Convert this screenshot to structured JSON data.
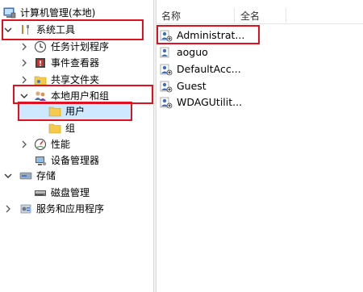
{
  "tree": {
    "root": {
      "label": "计算机管理(本地)",
      "icon": "computer-management-icon"
    },
    "system_tools": {
      "label": "系统工具",
      "icon": "tools-icon",
      "expanded": true
    },
    "task_scheduler": {
      "label": "任务计划程序",
      "icon": "clock-icon"
    },
    "event_viewer": {
      "label": "事件查看器",
      "icon": "event-viewer-icon"
    },
    "shared_folders": {
      "label": "共享文件夹",
      "icon": "shared-folder-icon"
    },
    "local_users_groups": {
      "label": "本地用户和组",
      "icon": "users-icon",
      "expanded": true
    },
    "users": {
      "label": "用户",
      "icon": "folder-icon",
      "selected": true
    },
    "groups": {
      "label": "组",
      "icon": "folder-icon"
    },
    "performance": {
      "label": "性能",
      "icon": "performance-icon"
    },
    "device_manager": {
      "label": "设备管理器",
      "icon": "device-manager-icon"
    },
    "storage": {
      "label": "存储",
      "icon": "storage-icon",
      "expanded": true
    },
    "disk_management": {
      "label": "磁盘管理",
      "icon": "disk-icon"
    },
    "services_apps": {
      "label": "服务和应用程序",
      "icon": "services-icon"
    }
  },
  "list": {
    "columns": [
      "名称",
      "全名"
    ],
    "rows": [
      {
        "name": "Administrat...",
        "icon": "user-icon"
      },
      {
        "name": "aoguo",
        "icon": "user-icon"
      },
      {
        "name": "DefaultAcc...",
        "icon": "user-icon"
      },
      {
        "name": "Guest",
        "icon": "user-icon"
      },
      {
        "name": "WDAGUtilit...",
        "icon": "user-icon"
      }
    ]
  },
  "colors": {
    "highlight": "#e0101e",
    "selection": "#cde8ff",
    "folder": "#f5c94a"
  }
}
